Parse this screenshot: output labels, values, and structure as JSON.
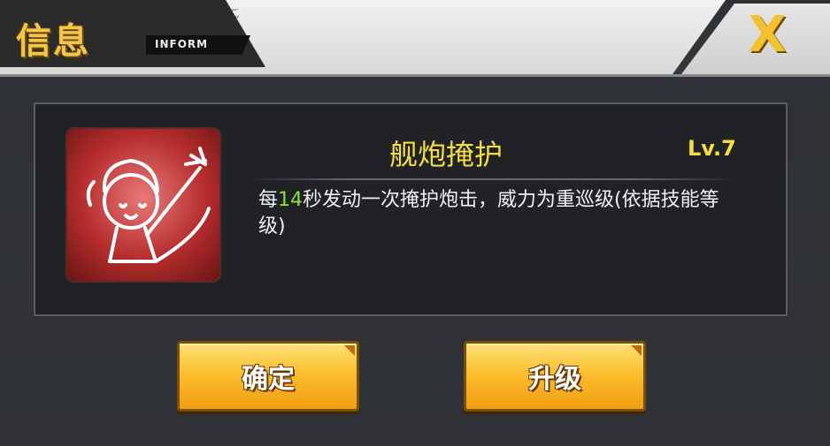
{
  "header": {
    "title": "信息",
    "subtitle": "INFORM",
    "close_label": "X"
  },
  "skill": {
    "name": "舰炮掩护",
    "level": "Lv.7",
    "desc_prefix": "每",
    "desc_highlight": "14",
    "desc_suffix": "秒发动一次掩护炮击，威力为重巡级(依据技能等级)"
  },
  "buttons": {
    "confirm": "确定",
    "upgrade": "升级"
  },
  "colors": {
    "accent_gold": "#f5df3d",
    "highlight_green": "#8ae234",
    "button_orange": "#fbbf2e",
    "icon_red": "#b62d2d"
  }
}
